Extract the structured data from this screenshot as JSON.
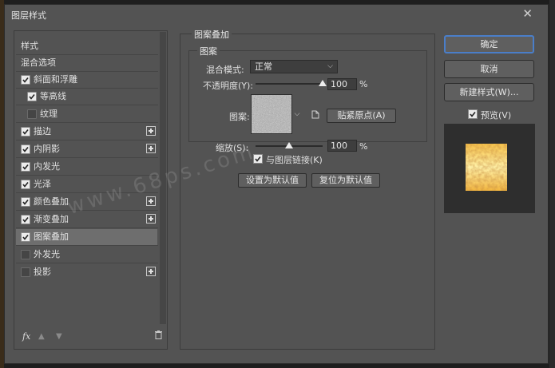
{
  "window": {
    "title": "图层样式",
    "close": "✕"
  },
  "left": {
    "items": [
      {
        "label": "样式",
        "checkbox": false,
        "checked": false,
        "plus": false,
        "indent": 0
      },
      {
        "label": "混合选项",
        "checkbox": false,
        "checked": false,
        "plus": false,
        "indent": 0
      },
      {
        "label": "斜面和浮雕",
        "checkbox": true,
        "checked": true,
        "plus": false,
        "indent": 0
      },
      {
        "label": "等高线",
        "checkbox": true,
        "checked": true,
        "plus": false,
        "indent": 1
      },
      {
        "label": "纹理",
        "checkbox": true,
        "checked": false,
        "plus": false,
        "indent": 1
      },
      {
        "label": "描边",
        "checkbox": true,
        "checked": true,
        "plus": true,
        "indent": 0
      },
      {
        "label": "内阴影",
        "checkbox": true,
        "checked": true,
        "plus": true,
        "indent": 0
      },
      {
        "label": "内发光",
        "checkbox": true,
        "checked": true,
        "plus": false,
        "indent": 0
      },
      {
        "label": "光泽",
        "checkbox": true,
        "checked": true,
        "plus": false,
        "indent": 0
      },
      {
        "label": "颜色叠加",
        "checkbox": true,
        "checked": true,
        "plus": true,
        "indent": 0
      },
      {
        "label": "渐变叠加",
        "checkbox": true,
        "checked": true,
        "plus": true,
        "indent": 0
      },
      {
        "label": "图案叠加",
        "checkbox": true,
        "checked": true,
        "plus": false,
        "indent": 0,
        "selected": true
      },
      {
        "label": "外发光",
        "checkbox": true,
        "checked": false,
        "plus": false,
        "indent": 0
      },
      {
        "label": "投影",
        "checkbox": true,
        "checked": false,
        "plus": true,
        "indent": 0
      }
    ],
    "fx": "fx"
  },
  "panel": {
    "title": "图案叠加",
    "group": "图案",
    "blend_label": "混合模式:",
    "blend_value": "正常",
    "opacity_label": "不透明度(Y):",
    "opacity_value": "100",
    "opacity_level": 1.0,
    "pattern_label": "图案:",
    "snap_button": "贴紧原点(A)",
    "scale_label": "缩放(S):",
    "scale_value": "100",
    "scale_level": 0.5,
    "percent": "%",
    "link_label": "与图层链接(K)",
    "link_checked": true,
    "default_button": "设置为默认值",
    "reset_button": "复位为默认值"
  },
  "right": {
    "ok": "确定",
    "cancel": "取消",
    "new_style": "新建样式(W)...",
    "preview_label": "预览(V)",
    "preview_checked": true
  },
  "watermark": "www.68ps.com",
  "colors": {
    "accent": "#4a7ec9",
    "dialog": "#535353",
    "selected": "#6e6e6e"
  }
}
